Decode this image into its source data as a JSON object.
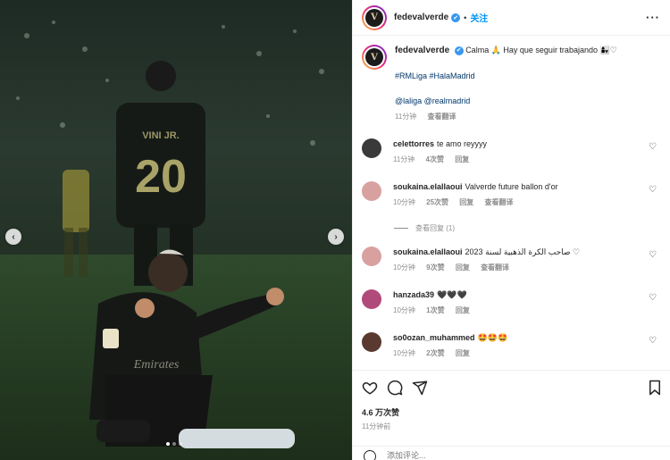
{
  "post": {
    "username": "fedevalverde",
    "follow_label": "关注",
    "more_icon": "more-icon",
    "separator": "•",
    "verified_mark": "✔"
  },
  "caption": {
    "username": "fedevalverde",
    "text": "Calma 🙏 Hay que seguir trabajando 👩‍👧♡",
    "hashtags": "#RMLiga #HalaMadrid",
    "mentions": "@laliga @realmadrid",
    "time": "11分钟",
    "translate": "查看翻译"
  },
  "comments": [
    {
      "user": "celettorres",
      "text": "te amo reyyyy",
      "time": "11分钟",
      "likes": "4次赞",
      "reply": "回复",
      "translate": "",
      "avatar_color": "#3a3a3a"
    },
    {
      "user": "soukaina.elallaoui",
      "text": "Valverde future ballon d'or",
      "time": "10分钟",
      "likes": "25次赞",
      "reply": "回复",
      "translate": "查看翻译",
      "avatar_color": "#d9a0a0"
    },
    {
      "user": "soukaina.elallaoui",
      "text": "2023 صاحب الكرة الذهبية لسنة ♡",
      "time": "10分钟",
      "likes": "9次赞",
      "reply": "回复",
      "translate": "查看翻译",
      "avatar_color": "#d9a0a0"
    },
    {
      "user": "hanzada39",
      "text": "🖤🖤🖤",
      "time": "10分钟",
      "likes": "1次赞",
      "reply": "回复",
      "translate": "",
      "avatar_color": "#b04a7a"
    },
    {
      "user": "so0ozan_muhammed",
      "text": "🤩🤩🤩",
      "time": "10分钟",
      "likes": "2次赞",
      "reply": "回复",
      "translate": "",
      "avatar_color": "#5a3a30"
    }
  ],
  "view_replies": "查看回复 (1)",
  "footer": {
    "likes": "4.6 万次赞",
    "time_ago": "11分钟前",
    "comment_placeholder": "添加评论..."
  },
  "media": {
    "jersey_number": "20",
    "jersey_name": "VINI JR.",
    "sponsor": "Emirates",
    "prev_icon": "chevron-left-icon",
    "next_icon": "chevron-right-icon",
    "prev_glyph": "‹",
    "next_glyph": "›",
    "slide_count": 3,
    "active_slide": 1
  },
  "colors": {
    "accent": "#0095f6",
    "link": "#00376b",
    "muted": "#8e8e8e"
  }
}
